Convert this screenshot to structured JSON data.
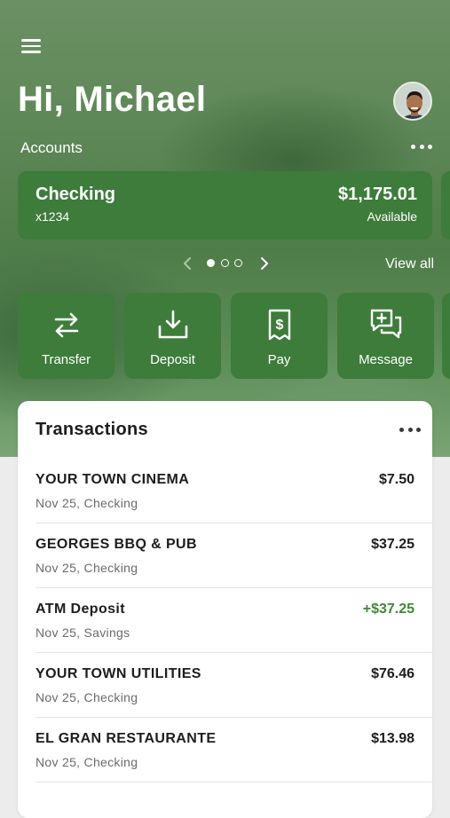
{
  "header": {
    "greeting": "Hi, Michael",
    "accounts_label": "Accounts"
  },
  "account": {
    "name": "Checking",
    "number": "x1234",
    "balance": "$1,175.01",
    "balance_label": "Available"
  },
  "carousel": {
    "page_count": 3,
    "current_page": 1,
    "view_all_label": "View all"
  },
  "actions": [
    {
      "label": "Transfer",
      "icon": "transfer-icon"
    },
    {
      "label": "Deposit",
      "icon": "deposit-icon"
    },
    {
      "label": "Pay",
      "icon": "pay-bill-icon"
    },
    {
      "label": "Message",
      "icon": "message-icon"
    }
  ],
  "transactions": {
    "title": "Transactions",
    "items": [
      {
        "merchant": "YOUR TOWN CINEMA",
        "meta": "Nov 25, Checking",
        "amount": "$7.50",
        "credit": false
      },
      {
        "merchant": "GEORGES BBQ & PUB",
        "meta": "Nov 25, Checking",
        "amount": "$37.25",
        "credit": false
      },
      {
        "merchant": "ATM Deposit",
        "meta": "Nov 25, Savings",
        "amount": "+$37.25",
        "credit": true
      },
      {
        "merchant": "YOUR TOWN UTILITIES",
        "meta": "Nov 25, Checking",
        "amount": "$76.46",
        "credit": false
      },
      {
        "merchant": "EL GRAN RESTAURANTE",
        "meta": "Nov 25, Checking",
        "amount": "$13.98",
        "credit": false
      }
    ]
  },
  "colors": {
    "brand_green": "#3d7c3a",
    "credit_green": "#3d8a35"
  }
}
